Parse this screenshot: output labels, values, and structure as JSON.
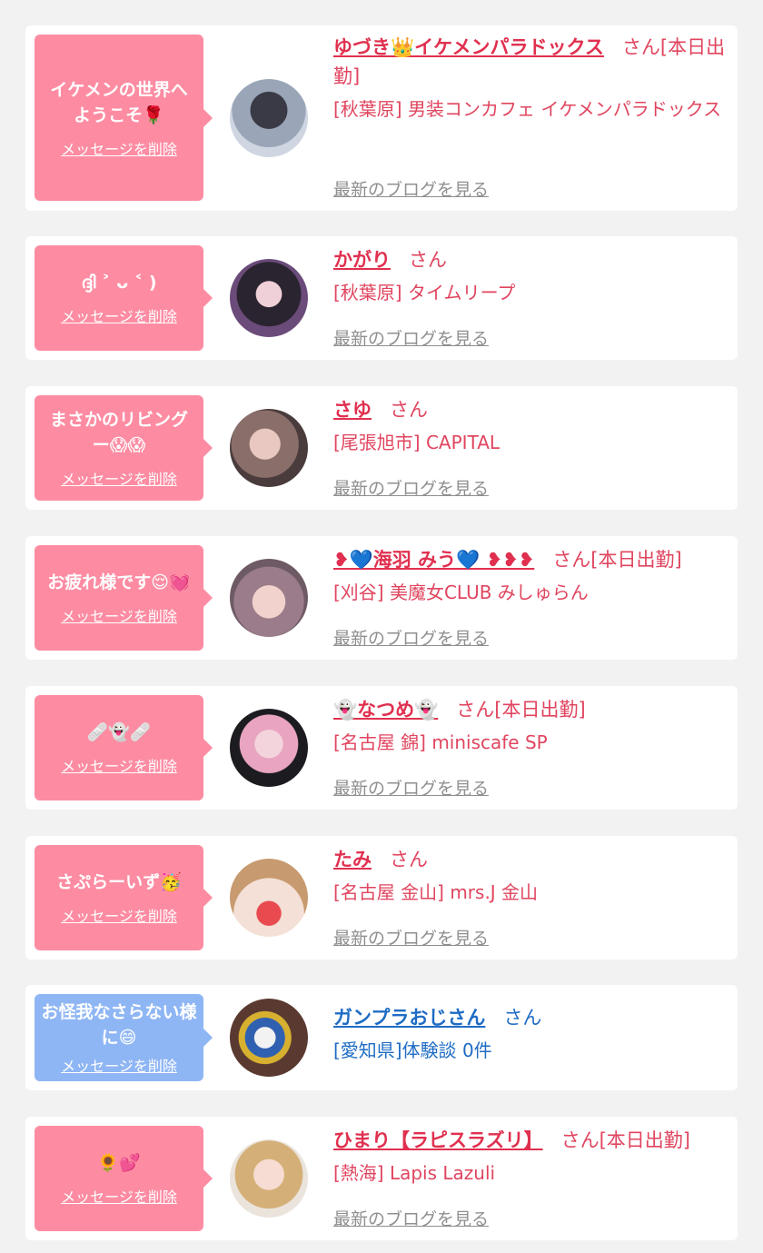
{
  "delete_label": "メッセージを削除",
  "blog_label": "最新のブログを見る",
  "colors": {
    "pink": "#fd8ca2",
    "blue": "#8fb6f4",
    "name": "#e0304f",
    "blue_text": "#1f6cc4"
  },
  "entries": [
    {
      "bubble": "イケメンの世界へようこそ🌹",
      "name": "ゆづき👑イケメンパラドックス",
      "suffix": "さん[本日出勤]",
      "shop": "[秋葉原] 男装コンカフェ イケメンパラドックス",
      "avatar": "avatar-photo"
    },
    {
      "bubble": "ദ്ദി ˃ ᴗ ˂ )",
      "name": "かがり",
      "suffix": "さん",
      "shop": "[秋葉原] タイムリープ",
      "avatar": "avatar-photo"
    },
    {
      "bubble": "まさかのリビングー😱😱",
      "name": "さゆ",
      "suffix": "さん",
      "shop": "[尾張旭市] CAPITAL",
      "avatar": "avatar-photo"
    },
    {
      "bubble": "お疲れ様です😌💓",
      "name": "❥💙海羽 みう💙 ❥❥❥",
      "suffix": "さん[本日出勤]",
      "shop": "[刈谷] 美魔女CLUB みしゅらん",
      "avatar": "avatar-photo"
    },
    {
      "bubble": "🩹👻🩹",
      "name": "👻なつめ👻",
      "suffix": "さん[本日出勤]",
      "shop": "[名古屋 錦] miniscafe SP",
      "avatar": "avatar-photo"
    },
    {
      "bubble": "さぷらーいず🥳",
      "name": "たみ",
      "suffix": "さん",
      "shop": "[名古屋 金山] mrs.J 金山",
      "avatar": "avatar-photo"
    },
    {
      "bubble": "お怪我なさらない様に😄",
      "name": "ガンプラおじさん",
      "suffix": "さん",
      "shop": "[愛知県]体験談 0件",
      "avatar": "avatar-photo"
    },
    {
      "bubble": "🌻💕",
      "name": "ひまり【ラピスラズリ】",
      "suffix": "さん[本日出勤]",
      "shop": "[熱海] Lapis Lazuli",
      "avatar": "avatar-photo"
    }
  ]
}
